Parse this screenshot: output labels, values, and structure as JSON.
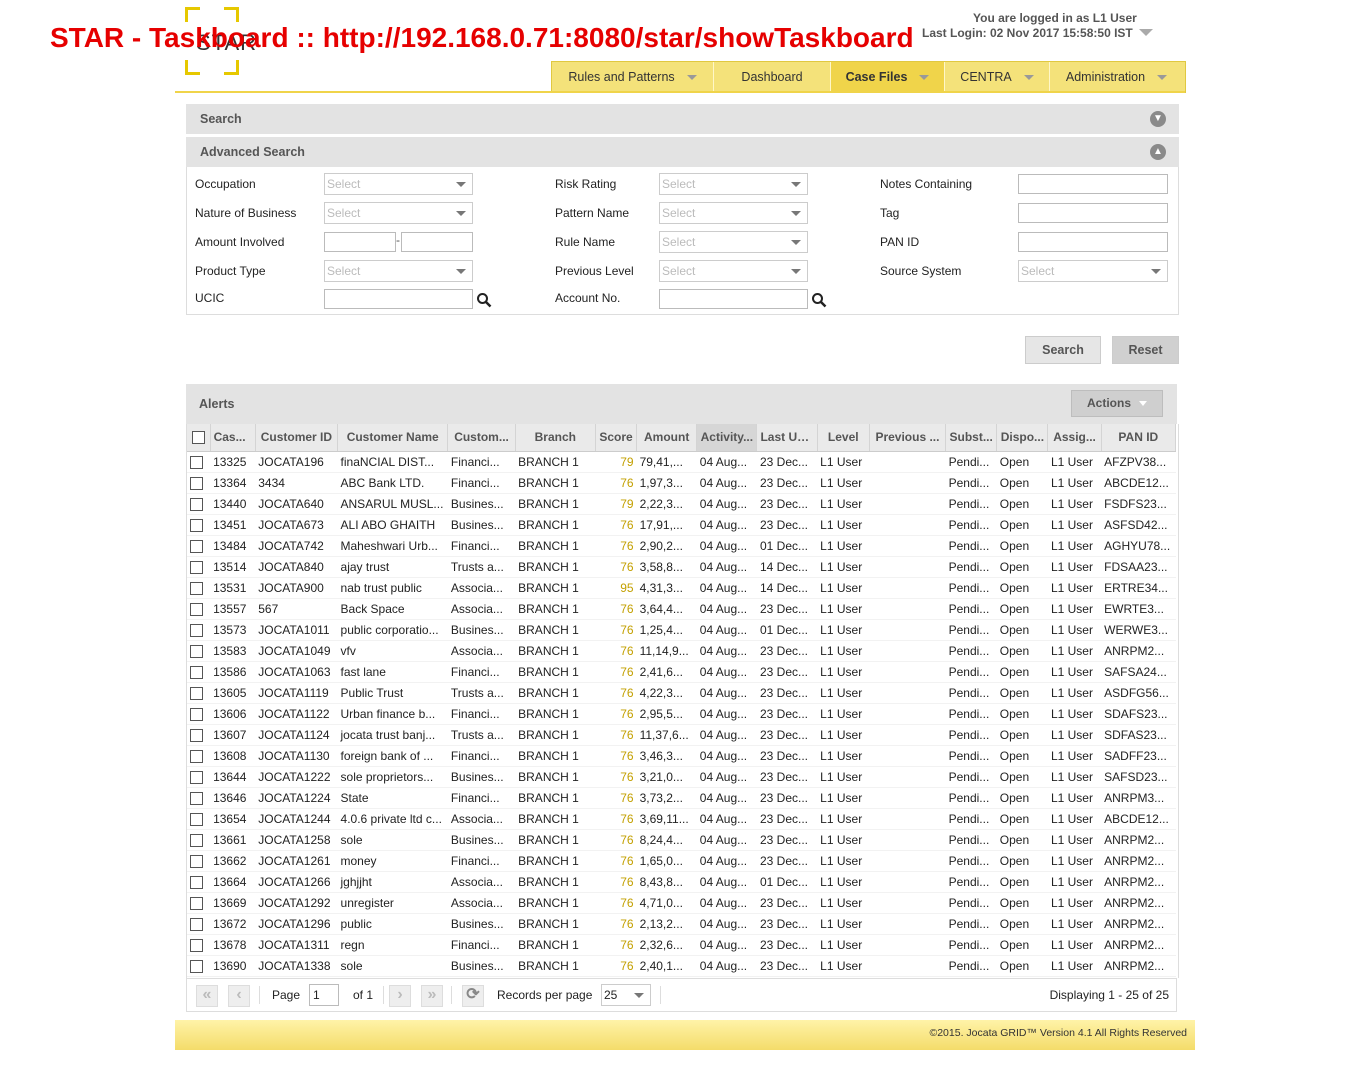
{
  "banner": "STAR - Taskboard :: http://192.168.0.71:8080/star/showTaskboard",
  "logo_text": "STAR",
  "user": {
    "logged_in": "You are logged in as L1 User",
    "last_login": "Last Login: 02 Nov 2017 15:58:50 IST"
  },
  "nav": [
    {
      "label": "Rules and Patterns",
      "caret": true
    },
    {
      "label": "Dashboard",
      "caret": false
    },
    {
      "label": "Case Files",
      "caret": true,
      "active": true
    },
    {
      "label": "CENTRA",
      "caret": true
    },
    {
      "label": "Administration",
      "caret": true
    }
  ],
  "search_panel": {
    "title": "Search"
  },
  "advanced_search": {
    "title": "Advanced Search",
    "occupation": "Occupation",
    "nature_of_business": "Nature of Business",
    "amount_involved": "Amount Involved",
    "product_type": "Product Type",
    "ucic": "UCIC",
    "risk_rating": "Risk Rating",
    "pattern_name": "Pattern Name",
    "rule_name": "Rule Name",
    "previous_level": "Previous Level",
    "account_no": "Account No.",
    "notes_containing": "Notes Containing",
    "tag": "Tag",
    "pan_id": "PAN ID",
    "source_system": "Source System",
    "select_placeholder": "Select",
    "amount_separator": "-"
  },
  "buttons": {
    "search": "Search",
    "reset": "Reset"
  },
  "alerts": {
    "title": "Alerts",
    "actions": "Actions",
    "columns": [
      "Cas...",
      "Customer ID",
      "Customer Name",
      "Custom...",
      "Branch",
      "Score",
      "Amount",
      "Activity...",
      "Last Up...",
      "Level",
      "Previous ...",
      "Subst...",
      "Dispo...",
      "Assig...",
      "PAN ID"
    ],
    "rows": [
      [
        "13325",
        "JOCATA196",
        "finaNCIAL DIST...",
        "Financi...",
        "BRANCH 1",
        "79",
        "79,41,...",
        "04 Aug...",
        "23 Dec...",
        "L1 User",
        "",
        "Pendi...",
        "Open",
        "L1 User",
        "AFZPV38..."
      ],
      [
        "13364",
        "3434",
        "ABC Bank LTD.",
        "Financi...",
        "BRANCH 1",
        "76",
        "1,97,3...",
        "04 Aug...",
        "23 Dec...",
        "L1 User",
        "",
        "Pendi...",
        "Open",
        "L1 User",
        "ABCDE12..."
      ],
      [
        "13440",
        "JOCATA640",
        "ANSARUL MUSL...",
        "Busines...",
        "BRANCH 1",
        "79",
        "2,22,3...",
        "04 Aug...",
        "23 Dec...",
        "L1 User",
        "",
        "Pendi...",
        "Open",
        "L1 User",
        "FSDFS23..."
      ],
      [
        "13451",
        "JOCATA673",
        "ALI ABO GHAITH",
        "Busines...",
        "BRANCH 1",
        "76",
        "17,91,...",
        "04 Aug...",
        "23 Dec...",
        "L1 User",
        "",
        "Pendi...",
        "Open",
        "L1 User",
        "ASFSD42..."
      ],
      [
        "13484",
        "JOCATA742",
        "Maheshwari Urb...",
        "Financi...",
        "BRANCH 1",
        "76",
        "2,90,2...",
        "04 Aug...",
        "01 Dec...",
        "L1 User",
        "",
        "Pendi...",
        "Open",
        "L1 User",
        "AGHYU78..."
      ],
      [
        "13514",
        "JOCATA840",
        "ajay trust",
        "Trusts a...",
        "BRANCH 1",
        "76",
        "3,58,8...",
        "04 Aug...",
        "14 Dec...",
        "L1 User",
        "",
        "Pendi...",
        "Open",
        "L1 User",
        "FDSAA23..."
      ],
      [
        "13531",
        "JOCATA900",
        "nab trust public",
        "Associa...",
        "BRANCH 1",
        "95",
        "4,31,3...",
        "04 Aug...",
        "14 Dec...",
        "L1 User",
        "",
        "Pendi...",
        "Open",
        "L1 User",
        "ERTRE34..."
      ],
      [
        "13557",
        "567",
        "Back Space",
        "Associa...",
        "BRANCH 1",
        "76",
        "3,64,4...",
        "04 Aug...",
        "23 Dec...",
        "L1 User",
        "",
        "Pendi...",
        "Open",
        "L1 User",
        "EWRTE3..."
      ],
      [
        "13573",
        "JOCATA1011",
        "public corporatio...",
        "Busines...",
        "BRANCH 1",
        "76",
        "1,25,4...",
        "04 Aug...",
        "01 Dec...",
        "L1 User",
        "",
        "Pendi...",
        "Open",
        "L1 User",
        "WERWE3..."
      ],
      [
        "13583",
        "JOCATA1049",
        "vfv",
        "Associa...",
        "BRANCH 1",
        "76",
        "11,14,9...",
        "04 Aug...",
        "23 Dec...",
        "L1 User",
        "",
        "Pendi...",
        "Open",
        "L1 User",
        "ANRPM2..."
      ],
      [
        "13586",
        "JOCATA1063",
        "fast lane",
        "Financi...",
        "BRANCH 1",
        "76",
        "2,41,6...",
        "04 Aug...",
        "23 Dec...",
        "L1 User",
        "",
        "Pendi...",
        "Open",
        "L1 User",
        "SAFSA24..."
      ],
      [
        "13605",
        "JOCATA1119",
        "Public Trust",
        "Trusts a...",
        "BRANCH 1",
        "76",
        "4,22,3...",
        "04 Aug...",
        "23 Dec...",
        "L1 User",
        "",
        "Pendi...",
        "Open",
        "L1 User",
        "ASDFG56..."
      ],
      [
        "13606",
        "JOCATA1122",
        "Urban finance b...",
        "Financi...",
        "BRANCH 1",
        "76",
        "2,95,5...",
        "04 Aug...",
        "23 Dec...",
        "L1 User",
        "",
        "Pendi...",
        "Open",
        "L1 User",
        "SDAFS23..."
      ],
      [
        "13607",
        "JOCATA1124",
        "jocata trust banj...",
        "Trusts a...",
        "BRANCH 1",
        "76",
        "11,37,6...",
        "04 Aug...",
        "23 Dec...",
        "L1 User",
        "",
        "Pendi...",
        "Open",
        "L1 User",
        "SDFAS23..."
      ],
      [
        "13608",
        "JOCATA1130",
        "foreign bank of ...",
        "Financi...",
        "BRANCH 1",
        "76",
        "3,46,3...",
        "04 Aug...",
        "23 Dec...",
        "L1 User",
        "",
        "Pendi...",
        "Open",
        "L1 User",
        "SADFF23..."
      ],
      [
        "13644",
        "JOCATA1222",
        "sole proprietors...",
        "Busines...",
        "BRANCH 1",
        "76",
        "3,21,0...",
        "04 Aug...",
        "23 Dec...",
        "L1 User",
        "",
        "Pendi...",
        "Open",
        "L1 User",
        "SAFSD23..."
      ],
      [
        "13646",
        "JOCATA1224",
        "State",
        "Financi...",
        "BRANCH 1",
        "76",
        "3,73,2...",
        "04 Aug...",
        "23 Dec...",
        "L1 User",
        "",
        "Pendi...",
        "Open",
        "L1 User",
        "ANRPM3..."
      ],
      [
        "13654",
        "JOCATA1244",
        "4.0.6 private ltd c...",
        "Associa...",
        "BRANCH 1",
        "76",
        "3,69,11...",
        "04 Aug...",
        "23 Dec...",
        "L1 User",
        "",
        "Pendi...",
        "Open",
        "L1 User",
        "ABCDE12..."
      ],
      [
        "13661",
        "JOCATA1258",
        "sole",
        "Busines...",
        "BRANCH 1",
        "76",
        "8,24,4...",
        "04 Aug...",
        "23 Dec...",
        "L1 User",
        "",
        "Pendi...",
        "Open",
        "L1 User",
        "ANRPM2..."
      ],
      [
        "13662",
        "JOCATA1261",
        "money",
        "Financi...",
        "BRANCH 1",
        "76",
        "1,65,0...",
        "04 Aug...",
        "23 Dec...",
        "L1 User",
        "",
        "Pendi...",
        "Open",
        "L1 User",
        "ANRPM2..."
      ],
      [
        "13664",
        "JOCATA1266",
        "jghjjht",
        "Associa...",
        "BRANCH 1",
        "76",
        "8,43,8...",
        "04 Aug...",
        "01 Dec...",
        "L1 User",
        "",
        "Pendi...",
        "Open",
        "L1 User",
        "ANRPM2..."
      ],
      [
        "13669",
        "JOCATA1292",
        "unregister",
        "Associa...",
        "BRANCH 1",
        "76",
        "4,71,0...",
        "04 Aug...",
        "23 Dec...",
        "L1 User",
        "",
        "Pendi...",
        "Open",
        "L1 User",
        "ANRPM2..."
      ],
      [
        "13672",
        "JOCATA1296",
        "public",
        "Busines...",
        "BRANCH 1",
        "76",
        "2,13,2...",
        "04 Aug...",
        "23 Dec...",
        "L1 User",
        "",
        "Pendi...",
        "Open",
        "L1 User",
        "ANRPM2..."
      ],
      [
        "13678",
        "JOCATA1311",
        "regn",
        "Financi...",
        "BRANCH 1",
        "76",
        "2,32,6...",
        "04 Aug...",
        "23 Dec...",
        "L1 User",
        "",
        "Pendi...",
        "Open",
        "L1 User",
        "ANRPM2..."
      ],
      [
        "13690",
        "JOCATA1338",
        "sole",
        "Busines...",
        "BRANCH 1",
        "76",
        "2,40,1...",
        "04 Aug...",
        "23 Dec...",
        "L1 User",
        "",
        "Pendi...",
        "Open",
        "L1 User",
        "ANRPM2..."
      ]
    ]
  },
  "pager": {
    "page_label": "Page",
    "page_value": "1",
    "of_label": "of 1",
    "records_label": "Records per page",
    "records_value": "25",
    "displaying": "Displaying 1 - 25 of 25"
  },
  "footer": "©2015. Jocata GRID™ Version 4.1 All Rights Reserved"
}
